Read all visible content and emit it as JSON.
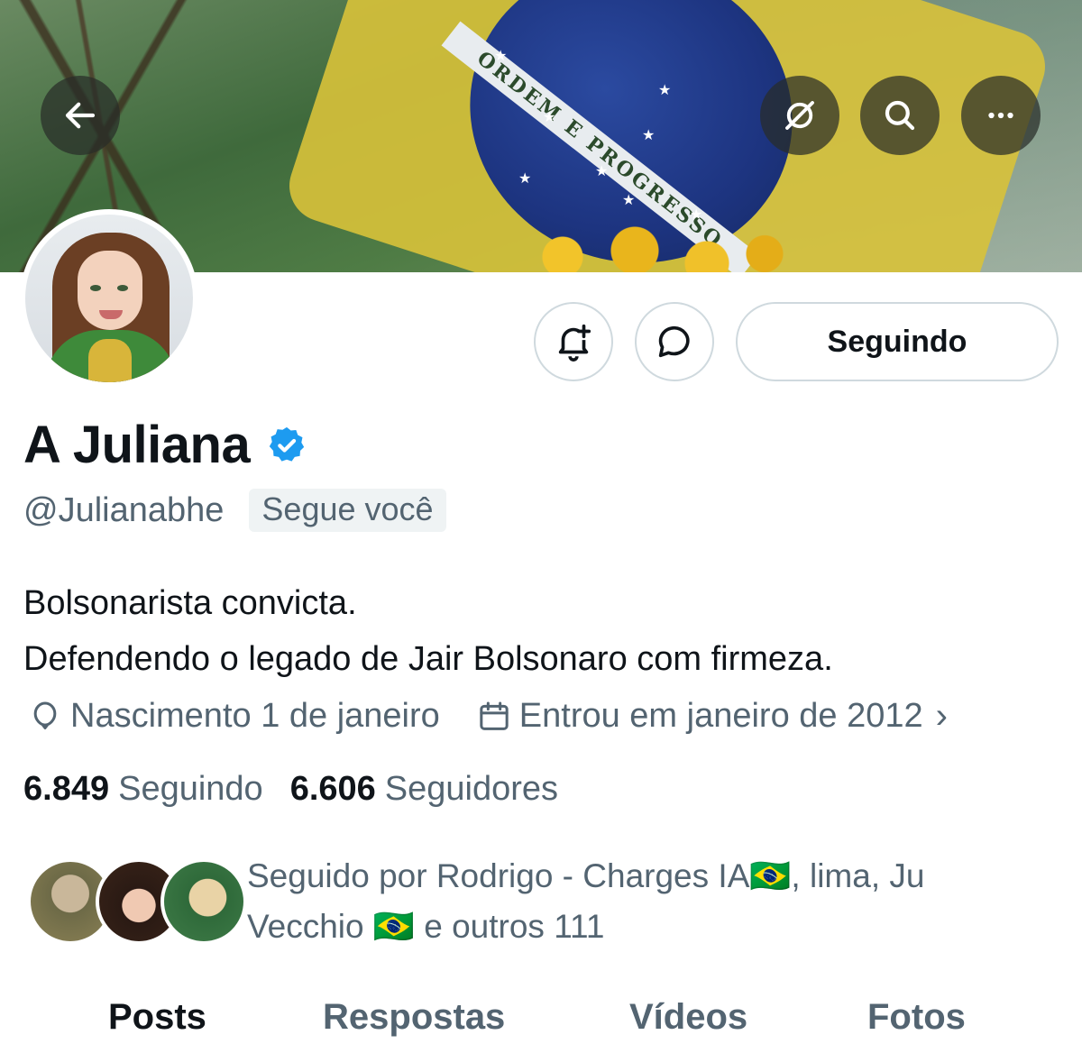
{
  "banner": {
    "flag_motto": "ORDEM E PROGRESSO"
  },
  "header_actions": {
    "back_icon": "arrow-left-icon",
    "grok_icon": "grok-icon",
    "search_icon": "search-icon",
    "more_icon": "more-horizontal-icon"
  },
  "profile": {
    "name": "A Juliana",
    "handle": "@Julianabhe",
    "follows_you": "Segue você",
    "bio_line1": "Bolsonarista convicta.",
    "bio_line2": "Defendendo o legado de Jair Bolsonaro com firmeza.",
    "birthday": "Nascimento 1 de janeiro",
    "joined": "Entrou em janeiro de 2012",
    "following_count": "6.849",
    "following_label": "Seguindo",
    "followers_count": "6.606",
    "followers_label": "Seguidores",
    "followed_by_line1": "Seguido por Rodrigo - Charges IA🇧🇷, lima, Ju",
    "followed_by_line2": "Vecchio 🇧🇷 e outros 111"
  },
  "actions": {
    "notify_icon": "bell-plus-icon",
    "message_icon": "chat-bubble-icon",
    "follow_label": "Seguindo"
  },
  "tabs": [
    {
      "label": "Posts",
      "active": true
    },
    {
      "label": "Respostas",
      "active": false
    },
    {
      "label": "Vídeos",
      "active": false
    },
    {
      "label": "Fotos",
      "active": false
    }
  ],
  "colors": {
    "accent": "#1d9bf0",
    "text_primary": "#0f1419",
    "text_secondary": "#536471",
    "border": "#cfd9de"
  }
}
